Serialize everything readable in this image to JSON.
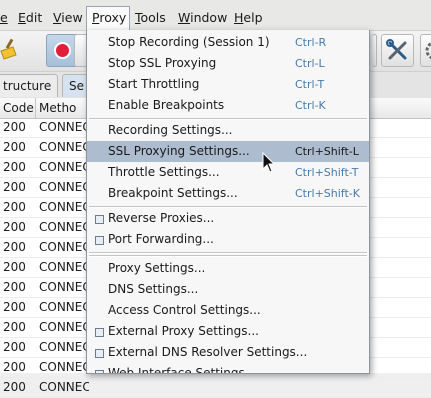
{
  "menubar": {
    "items": [
      "e",
      "Edit",
      "View",
      "Proxy",
      "Tools",
      "Window",
      "Help"
    ]
  },
  "view_tabs": [
    "tructure",
    "Se"
  ],
  "table": {
    "headers": [
      "Code",
      "Metho"
    ],
    "rows": [
      {
        "code": "200",
        "method": "CONNEC"
      },
      {
        "code": "200",
        "method": "CONNEC"
      },
      {
        "code": "200",
        "method": "CONNEC"
      },
      {
        "code": "200",
        "method": "CONNEC"
      },
      {
        "code": "200",
        "method": "CONNEC"
      },
      {
        "code": "200",
        "method": "CONNEC"
      },
      {
        "code": "200",
        "method": "CONNEC"
      },
      {
        "code": "200",
        "method": "CONNEC"
      },
      {
        "code": "200",
        "method": "CONNEC"
      },
      {
        "code": "200",
        "method": "CONNEC"
      },
      {
        "code": "200",
        "method": "CONNEC"
      },
      {
        "code": "200",
        "method": "CONNEC"
      },
      {
        "code": "200",
        "method": "CONNEC"
      },
      {
        "code": "200",
        "method": "CONNEC"
      }
    ]
  },
  "proxy_menu": {
    "stop_recording": {
      "label": "Stop Recording (Session 1)",
      "shortcut": "Ctrl-R"
    },
    "stop_ssl": {
      "label": "Stop SSL Proxying",
      "shortcut": "Ctrl-L"
    },
    "start_throttling": {
      "label": "Start Throttling",
      "shortcut": "Ctrl-T"
    },
    "enable_breakpoints": {
      "label": "Enable Breakpoints",
      "shortcut": "Ctrl-K"
    },
    "recording_settings": {
      "label": "Recording Settings..."
    },
    "ssl_settings": {
      "label": "SSL Proxying Settings...",
      "shortcut": "Ctrl+Shift-L"
    },
    "throttle_settings": {
      "label": "Throttle Settings...",
      "shortcut": "Ctrl+Shift-T"
    },
    "breakpoint_settings": {
      "label": "Breakpoint Settings...",
      "shortcut": "Ctrl+Shift-K"
    },
    "reverse_proxies": {
      "label": "Reverse Proxies..."
    },
    "port_forwarding": {
      "label": "Port Forwarding..."
    },
    "proxy_settings": {
      "label": "Proxy Settings..."
    },
    "dns_settings": {
      "label": "DNS Settings..."
    },
    "access_control": {
      "label": "Access Control Settings..."
    },
    "external_proxy": {
      "label": "External Proxy Settings..."
    },
    "external_dns": {
      "label": "External DNS Resolver Settings..."
    },
    "web_interface": {
      "label": "Web Interface Settings..."
    }
  },
  "colors": {
    "highlight": "#aebccf",
    "shortcut": "#4a7aa8",
    "record": "#e0203a"
  },
  "icons": [
    "broom-icon",
    "record-icon",
    "tools-icon",
    "gear-icon",
    "mouse-pointer-icon"
  ]
}
